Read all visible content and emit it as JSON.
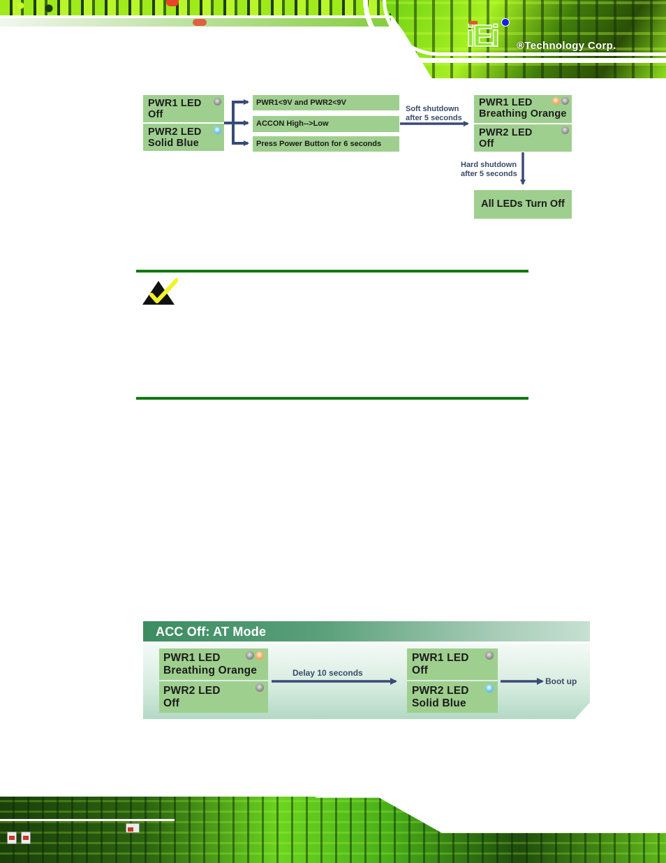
{
  "header": {
    "logo_mark": "iEi",
    "logo_text": "®Technology Corp."
  },
  "acc_on_shutdown_diagram": {
    "start_state": [
      {
        "led": "PWR1 LED",
        "status": "Off",
        "indicators": [
          "off"
        ]
      },
      {
        "led": "PWR2 LED",
        "status": "Solid Blue",
        "indicators": [
          "blue"
        ]
      }
    ],
    "conditions": [
      "PWR1<9V and PWR2<9V",
      "ACCON High-->Low",
      "Press Power Button for 6 seconds"
    ],
    "soft_shutdown_label": [
      "Soft shutdown",
      "after 5 seconds"
    ],
    "mid_state": [
      {
        "led": "PWR1 LED",
        "status": "Breathing Orange",
        "indicators": [
          "orange",
          "off"
        ]
      },
      {
        "led": "PWR2 LED",
        "status": "Off",
        "indicators": [
          "off"
        ]
      }
    ],
    "hard_shutdown_label": [
      "Hard shutdown",
      "after 5 seconds"
    ],
    "end_state": "All LEDs Turn Off"
  },
  "note": {
    "icon": "note-checkmark-icon"
  },
  "acc_off_at_mode_diagram": {
    "title": "ACC Off: AT Mode",
    "start_state": [
      {
        "led": "PWR1 LED",
        "status": "Breathing Orange",
        "indicators": [
          "off",
          "orange"
        ]
      },
      {
        "led": "PWR2 LED",
        "status": "Off",
        "indicators": [
          "off"
        ]
      }
    ],
    "delay_label": "Delay 10 seconds",
    "end_state": [
      {
        "led": "PWR1 LED",
        "status": "Off",
        "indicators": [
          "off"
        ]
      },
      {
        "led": "PWR2 LED",
        "status": "Solid Blue",
        "indicators": [
          "blue"
        ]
      }
    ],
    "result_label": "Boot up"
  },
  "colors": {
    "box_green": "#9fcf8f",
    "arrow_navy": "#3a4a78",
    "note_rule_green": "#0f7a10",
    "at_title_green": "#3c8c62"
  }
}
